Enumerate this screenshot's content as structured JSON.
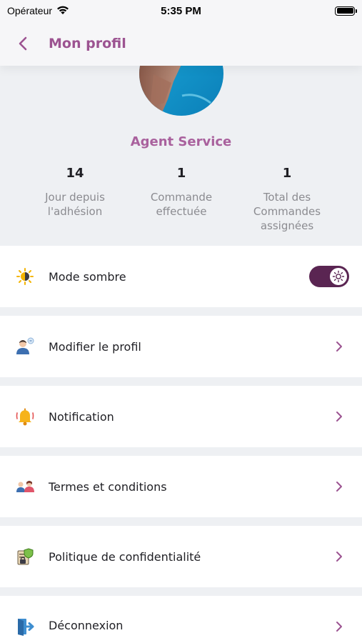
{
  "status_bar": {
    "carrier": "Opérateur",
    "time": "5:35 PM"
  },
  "header": {
    "title": "Mon profil"
  },
  "profile": {
    "name": "Agent Service",
    "stats": [
      {
        "value": "14",
        "label": "Jour depuis l'adhésion"
      },
      {
        "value": "1",
        "label": "Commande effectuée"
      },
      {
        "value": "1",
        "label": "Total des Commandes assignées"
      }
    ]
  },
  "menu": {
    "dark_mode": {
      "label": "Mode sombre",
      "icon": "sun-moon-icon",
      "enabled": true
    },
    "items": [
      {
        "label": "Modifier le profil",
        "icon": "user-edit-icon"
      },
      {
        "label": "Notification",
        "icon": "bell-icon"
      },
      {
        "label": "Termes et conditions",
        "icon": "people-icon"
      },
      {
        "label": "Politique de confidentialité",
        "icon": "privacy-shield-icon"
      },
      {
        "label": "Déconnexion",
        "icon": "logout-door-icon"
      }
    ]
  },
  "colors": {
    "accent": "#9c5391",
    "name": "#a9619d",
    "toggle": "#5a2552",
    "background": "#eef0f3"
  }
}
